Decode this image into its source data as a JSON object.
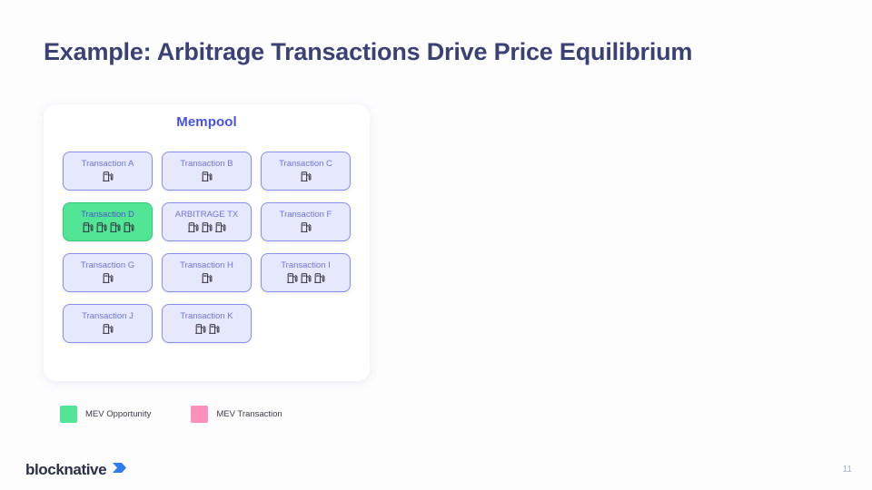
{
  "slide": {
    "title": "Example: Arbitrage Transactions Drive Price Equilibrium",
    "page_number": "11"
  },
  "mempool": {
    "heading": "Mempool",
    "rows": [
      [
        {
          "label": "Transaction A",
          "gas_icons": 1,
          "highlight": false
        },
        {
          "label": "Transaction B",
          "gas_icons": 1,
          "highlight": false
        },
        {
          "label": "Transaction C",
          "gas_icons": 1,
          "highlight": false
        }
      ],
      [
        {
          "label": "Transaction D",
          "gas_icons": 4,
          "highlight": true
        },
        {
          "label": "ARBITRAGE TX",
          "gas_icons": 3,
          "highlight": false
        },
        {
          "label": "Transaction F",
          "gas_icons": 1,
          "highlight": false
        }
      ],
      [
        {
          "label": "Transaction G",
          "gas_icons": 1,
          "highlight": false
        },
        {
          "label": "Transaction H",
          "gas_icons": 1,
          "highlight": false
        },
        {
          "label": "Transaction I",
          "gas_icons": 3,
          "highlight": false
        }
      ],
      [
        {
          "label": "Transaction J",
          "gas_icons": 1,
          "highlight": false
        },
        {
          "label": "Transaction K",
          "gas_icons": 2,
          "highlight": false
        }
      ]
    ]
  },
  "legend": {
    "items": [
      {
        "label": "MEV Opportunity",
        "color": "#52e596"
      },
      {
        "label": "MEV Transaction",
        "color": "#fc8fbb"
      }
    ]
  },
  "footer": {
    "logo_text": "blocknative",
    "logo_mark_color": "#2c7df0"
  },
  "colors": {
    "page_background": "#fdfdfe",
    "title": "#3a4275",
    "mempool_heading": "#4850e8",
    "card_fill": "#e6e8fb",
    "card_border": "#8b8fe8",
    "card_label": "#6f76d8",
    "highlight_fill": "#52e596"
  },
  "icons": {
    "gas_pump": "gas-pump-icon"
  }
}
